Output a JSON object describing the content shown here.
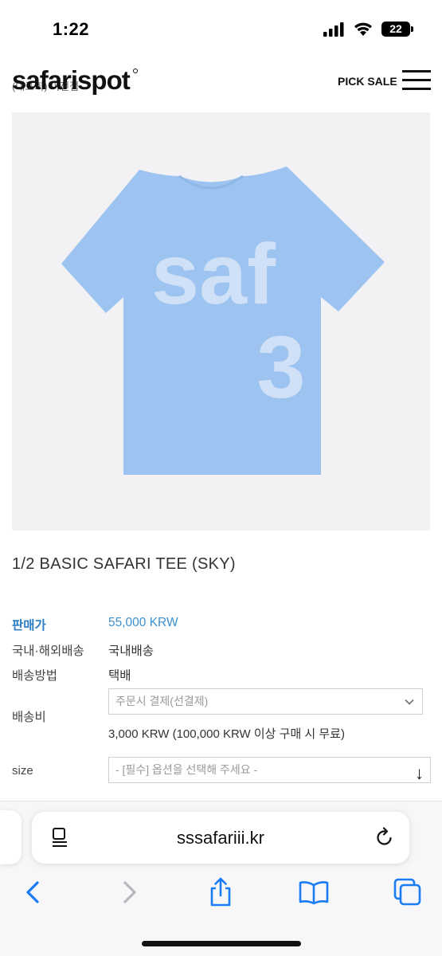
{
  "status_bar": {
    "time": "1:22",
    "battery": "22",
    "icons": [
      "signal-icon",
      "wifi-icon",
      "battery-icon"
    ]
  },
  "header": {
    "logo": "safarispot",
    "logo_subtext": "(대표회) 미전점",
    "nav_link": "PICK SALE",
    "menu_icon": "hamburger-menu-icon"
  },
  "product": {
    "image_print_top": "saf",
    "image_print_bottom": "3",
    "image_colors": {
      "background": "#f2f2f4",
      "shirt": "#9dc4f0",
      "print": "#cfe0f7"
    },
    "name": "1/2 BASIC SAFARI TEE (SKY)"
  },
  "info": {
    "price_label": "판매가",
    "price_value": "55,000 KRW",
    "shipping_scope_label": "국내·해외배송",
    "shipping_scope_value": "국내배송",
    "shipping_method_label": "배송방법",
    "shipping_method_value": "택배",
    "shipping_fee_label": "배송비",
    "shipping_fee_select": "주문시 결제(선결제)",
    "shipping_fee_note": "3,000 KRW (100,000 KRW 이상 구매 시 무료)",
    "size_label": "size",
    "size_select_placeholder": "- [필수] 옵션을 선택해 주세요 -"
  },
  "browser": {
    "url": "sssafariii.kr",
    "toolbar": [
      "back-icon",
      "forward-icon",
      "share-icon",
      "bookmarks-icon",
      "tabs-icon"
    ],
    "accent": "#1a7cf5"
  }
}
